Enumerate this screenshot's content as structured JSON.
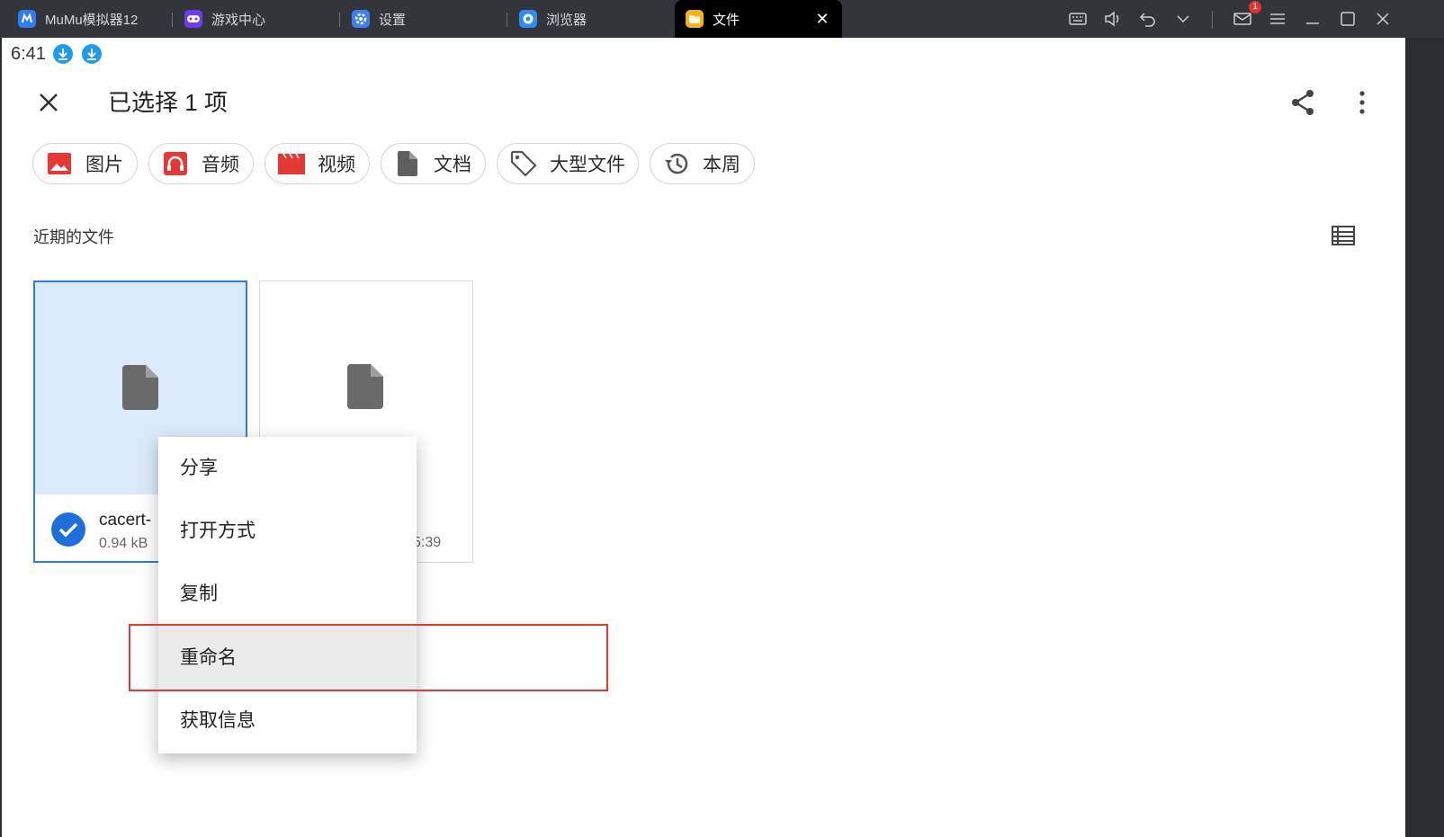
{
  "window": {
    "tabs": [
      {
        "label": "MuMu模拟器12",
        "icon": "mumu-logo-icon",
        "color": "#2f7cf6"
      },
      {
        "label": "游戏中心",
        "icon": "gamepad-icon",
        "color": "#6c3cf0"
      },
      {
        "label": "设置",
        "icon": "settings-gear-icon",
        "color": "#3d7ef5"
      },
      {
        "label": "浏览器",
        "icon": "browser-icon",
        "color": "#2f8cf5"
      },
      {
        "label": "文件",
        "icon": "folder-icon",
        "color": "#f5b21b"
      }
    ],
    "mail_badge": "1"
  },
  "status": {
    "time": "6:41"
  },
  "appbar": {
    "title": "已选择 1 项"
  },
  "chips": [
    {
      "label": "图片",
      "icon": "image-icon",
      "color": "#e53935"
    },
    {
      "label": "音频",
      "icon": "headphones-icon",
      "color": "#e53935"
    },
    {
      "label": "视频",
      "icon": "clapperboard-icon",
      "color": "#e53935"
    },
    {
      "label": "文档",
      "icon": "document-icon",
      "color": "#555555"
    },
    {
      "label": "大型文件",
      "icon": "tag-icon",
      "color": "#555555"
    },
    {
      "label": "本周",
      "icon": "history-icon",
      "color": "#555555"
    }
  ],
  "section": {
    "title": "近期的文件"
  },
  "files": [
    {
      "name": "cacert-",
      "meta": "0.94 kB",
      "selected": true
    },
    {
      "name": "",
      "meta": "5:39",
      "selected": false
    }
  ],
  "menu": {
    "items": [
      "分享",
      "打开方式",
      "复制",
      "重命名",
      "获取信息"
    ],
    "highlighted_index": 3
  },
  "colors": {
    "accent": "#2b7de0",
    "highlight_box": "#e53935"
  }
}
